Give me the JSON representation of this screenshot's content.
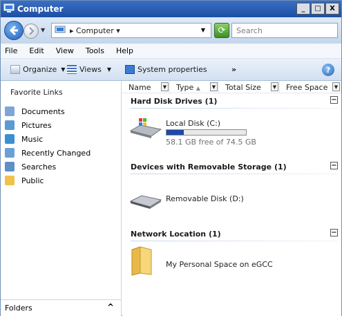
{
  "window": {
    "title": "Computer"
  },
  "title_buttons": {
    "minimize": "_",
    "maximize": "□",
    "close": "X"
  },
  "address": {
    "location": "Computer",
    "search_placeholder": "Search"
  },
  "menu": {
    "file": "File",
    "edit": "Edit",
    "view": "View",
    "tools": "Tools",
    "help": "Help"
  },
  "toolbar": {
    "organize": "Organize",
    "views": "Views",
    "system_properties": "System properties",
    "more": "»",
    "help": "?"
  },
  "favorites": {
    "title": "Favorite Links",
    "items": [
      {
        "label": "Documents",
        "icon": "documents-icon"
      },
      {
        "label": "Pictures",
        "icon": "pictures-icon"
      },
      {
        "label": "Music",
        "icon": "music-icon"
      },
      {
        "label": "Recently Changed",
        "icon": "recently-changed-icon"
      },
      {
        "label": "Searches",
        "icon": "searches-icon"
      },
      {
        "label": "Public",
        "icon": "public-folder-icon"
      }
    ]
  },
  "folders": {
    "label": "Folders",
    "chevron": "^"
  },
  "columns": [
    "Name",
    "Type",
    "Total Size",
    "Free Space"
  ],
  "sort_indicator": "▲",
  "groups": {
    "hdd": {
      "title": "Hard Disk Drives (1)"
    },
    "removable": {
      "title": "Devices with Removable Storage (1)"
    },
    "network": {
      "title": "Network Location (1)"
    }
  },
  "drives": {
    "local": {
      "label": "Local Disk (C:)",
      "free_text": "58.1 GB free of 74.5 GB",
      "used_fraction": 0.22
    },
    "removable": {
      "label": "Removable Disk (D:)"
    },
    "network": {
      "label": "My Personal Space on eGCC"
    }
  },
  "collapse_symbol": "−"
}
